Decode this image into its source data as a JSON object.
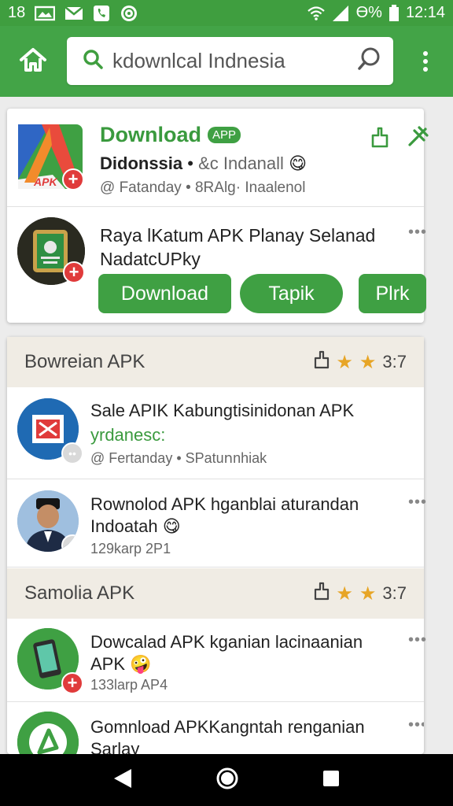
{
  "status_bar": {
    "left_text": "18",
    "battery_pct": "Ө%",
    "time": "12:14"
  },
  "search": {
    "query": "kdownlcal Indnesia"
  },
  "featured": {
    "icon_label": "APK",
    "title": "Download",
    "badge": "APP",
    "subtitle_bold": "Didonssia",
    "subtitle_sep": " • ",
    "subtitle_light": "&c Indanall",
    "emoji": "😋",
    "meta": "@ Fatanday • 8RAlg· Inaalenol"
  },
  "promo": {
    "text": "Raya lKatum APK Planay Selanad NadatcUPky",
    "more": "•••",
    "buttons": [
      "Download",
      "Tapik",
      "Plrk"
    ]
  },
  "sections": [
    {
      "title": "Bowreian APK",
      "rating": "3:7",
      "rows": [
        {
          "title": "Sale APIK Kabungtisinidonan APK",
          "green": "yrdanesc:",
          "meta": "@ Fertanday • SPatuոnhiak"
        },
        {
          "title": "Rownolod APK hganblai aturandan Indoatah",
          "emoji": "😋",
          "meta": "129karp 2P1",
          "more": "•••"
        }
      ]
    },
    {
      "title": "Samolia APK",
      "rating": "3:7",
      "rows": [
        {
          "title": "Dowcalad APK kganian lacinaanian APK",
          "emoji": "🤪",
          "meta": "133larp AP4",
          "more": "•••"
        },
        {
          "title": "Gomnload APKKangntah renganian Sarlay",
          "more": "•••"
        }
      ]
    }
  ],
  "colors": {
    "primary_green": "#43a447",
    "status_green": "#3f9e3f",
    "badge_red": "#e03b3b",
    "star_gold": "#e7a526"
  },
  "icons": [
    "search-icon",
    "home-icon",
    "overflow-menu-icon",
    "share-icon",
    "pin-icon",
    "bookmark-icon",
    "star-icon",
    "back-icon",
    "home-circle-icon",
    "recents-icon"
  ]
}
